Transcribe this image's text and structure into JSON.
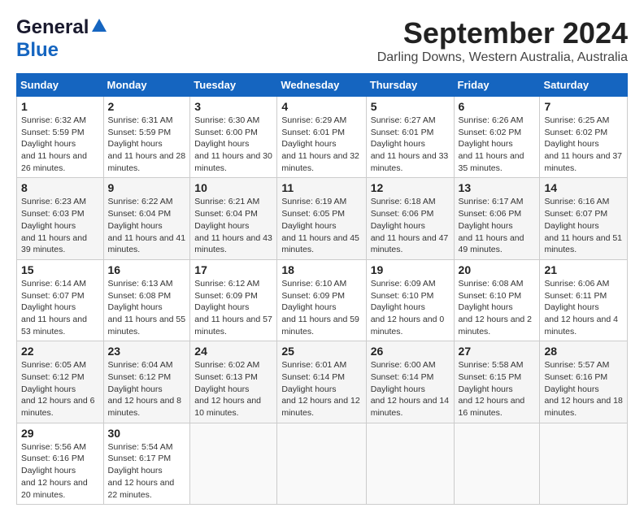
{
  "logo": {
    "line1": "General",
    "line2": "Blue"
  },
  "title": "September 2024",
  "subtitle": "Darling Downs, Western Australia, Australia",
  "days_header": [
    "Sunday",
    "Monday",
    "Tuesday",
    "Wednesday",
    "Thursday",
    "Friday",
    "Saturday"
  ],
  "weeks": [
    [
      {
        "num": "1",
        "sunrise": "6:32 AM",
        "sunset": "5:59 PM",
        "daylight": "11 hours and 26 minutes."
      },
      {
        "num": "2",
        "sunrise": "6:31 AM",
        "sunset": "5:59 PM",
        "daylight": "11 hours and 28 minutes."
      },
      {
        "num": "3",
        "sunrise": "6:30 AM",
        "sunset": "6:00 PM",
        "daylight": "11 hours and 30 minutes."
      },
      {
        "num": "4",
        "sunrise": "6:29 AM",
        "sunset": "6:01 PM",
        "daylight": "11 hours and 32 minutes."
      },
      {
        "num": "5",
        "sunrise": "6:27 AM",
        "sunset": "6:01 PM",
        "daylight": "11 hours and 33 minutes."
      },
      {
        "num": "6",
        "sunrise": "6:26 AM",
        "sunset": "6:02 PM",
        "daylight": "11 hours and 35 minutes."
      },
      {
        "num": "7",
        "sunrise": "6:25 AM",
        "sunset": "6:02 PM",
        "daylight": "11 hours and 37 minutes."
      }
    ],
    [
      {
        "num": "8",
        "sunrise": "6:23 AM",
        "sunset": "6:03 PM",
        "daylight": "11 hours and 39 minutes."
      },
      {
        "num": "9",
        "sunrise": "6:22 AM",
        "sunset": "6:04 PM",
        "daylight": "11 hours and 41 minutes."
      },
      {
        "num": "10",
        "sunrise": "6:21 AM",
        "sunset": "6:04 PM",
        "daylight": "11 hours and 43 minutes."
      },
      {
        "num": "11",
        "sunrise": "6:19 AM",
        "sunset": "6:05 PM",
        "daylight": "11 hours and 45 minutes."
      },
      {
        "num": "12",
        "sunrise": "6:18 AM",
        "sunset": "6:06 PM",
        "daylight": "11 hours and 47 minutes."
      },
      {
        "num": "13",
        "sunrise": "6:17 AM",
        "sunset": "6:06 PM",
        "daylight": "11 hours and 49 minutes."
      },
      {
        "num": "14",
        "sunrise": "6:16 AM",
        "sunset": "6:07 PM",
        "daylight": "11 hours and 51 minutes."
      }
    ],
    [
      {
        "num": "15",
        "sunrise": "6:14 AM",
        "sunset": "6:07 PM",
        "daylight": "11 hours and 53 minutes."
      },
      {
        "num": "16",
        "sunrise": "6:13 AM",
        "sunset": "6:08 PM",
        "daylight": "11 hours and 55 minutes."
      },
      {
        "num": "17",
        "sunrise": "6:12 AM",
        "sunset": "6:09 PM",
        "daylight": "11 hours and 57 minutes."
      },
      {
        "num": "18",
        "sunrise": "6:10 AM",
        "sunset": "6:09 PM",
        "daylight": "11 hours and 59 minutes."
      },
      {
        "num": "19",
        "sunrise": "6:09 AM",
        "sunset": "6:10 PM",
        "daylight": "12 hours and 0 minutes."
      },
      {
        "num": "20",
        "sunrise": "6:08 AM",
        "sunset": "6:10 PM",
        "daylight": "12 hours and 2 minutes."
      },
      {
        "num": "21",
        "sunrise": "6:06 AM",
        "sunset": "6:11 PM",
        "daylight": "12 hours and 4 minutes."
      }
    ],
    [
      {
        "num": "22",
        "sunrise": "6:05 AM",
        "sunset": "6:12 PM",
        "daylight": "12 hours and 6 minutes."
      },
      {
        "num": "23",
        "sunrise": "6:04 AM",
        "sunset": "6:12 PM",
        "daylight": "12 hours and 8 minutes."
      },
      {
        "num": "24",
        "sunrise": "6:02 AM",
        "sunset": "6:13 PM",
        "daylight": "12 hours and 10 minutes."
      },
      {
        "num": "25",
        "sunrise": "6:01 AM",
        "sunset": "6:14 PM",
        "daylight": "12 hours and 12 minutes."
      },
      {
        "num": "26",
        "sunrise": "6:00 AM",
        "sunset": "6:14 PM",
        "daylight": "12 hours and 14 minutes."
      },
      {
        "num": "27",
        "sunrise": "5:58 AM",
        "sunset": "6:15 PM",
        "daylight": "12 hours and 16 minutes."
      },
      {
        "num": "28",
        "sunrise": "5:57 AM",
        "sunset": "6:16 PM",
        "daylight": "12 hours and 18 minutes."
      }
    ],
    [
      {
        "num": "29",
        "sunrise": "5:56 AM",
        "sunset": "6:16 PM",
        "daylight": "12 hours and 20 minutes."
      },
      {
        "num": "30",
        "sunrise": "5:54 AM",
        "sunset": "6:17 PM",
        "daylight": "12 hours and 22 minutes."
      },
      null,
      null,
      null,
      null,
      null
    ]
  ]
}
